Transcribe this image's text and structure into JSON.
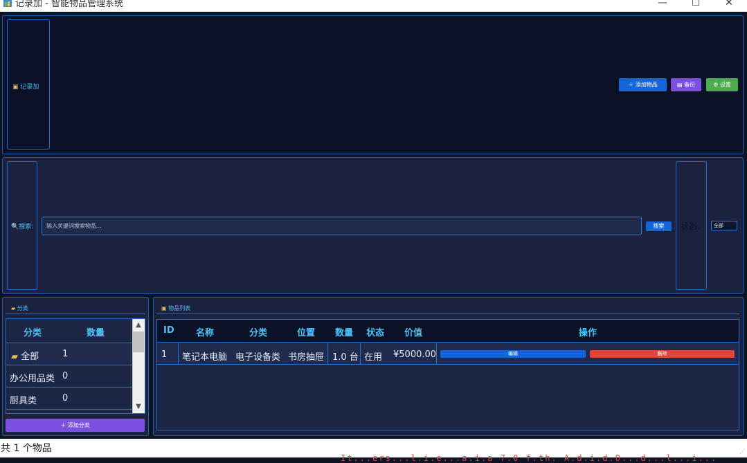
{
  "window": {
    "title": "记录加 - 智能物品管理系统",
    "controls": {
      "minimize": "—",
      "maximize": "☐",
      "close": "✕"
    }
  },
  "header": {
    "brand": "记录加",
    "buttons": {
      "add_item": "添加物品",
      "backup": "备份",
      "settings": "设置"
    }
  },
  "search": {
    "label": "搜索:",
    "placeholder": "输入关键词搜索物品...",
    "button": "搜索",
    "status_label": "状态:",
    "status_value": "全部"
  },
  "categories": {
    "title": "分类",
    "columns": [
      "分类",
      "数量"
    ],
    "rows": [
      {
        "name": "全部",
        "count": "1"
      },
      {
        "name": "办公用品类",
        "count": "0"
      },
      {
        "name": "厨具类",
        "count": "0"
      }
    ],
    "add_button": "添加分类"
  },
  "items": {
    "title": "物品列表",
    "columns": [
      "ID",
      "名称",
      "分类",
      "位置",
      "数量",
      "状态",
      "价值",
      "操作"
    ],
    "rows": [
      {
        "id": "1",
        "name": "笔记本电脑",
        "category": "电子设备类",
        "location": "书房抽屉",
        "quantity": "1.0 台",
        "status": "在用",
        "value": "¥5000.00",
        "edit": "编辑",
        "delete": "删除"
      }
    ]
  },
  "statusbar": {
    "count": "共 1 个物品",
    "console": "It...ers...l.i.e...a.i.a 7.0 f.th. A.d.i.d.O...d...l...i..."
  },
  "colors": {
    "background": "#0e1424",
    "panel": "#1a2240",
    "accent": "#4fc3f7",
    "border": "#1e6fd6",
    "primary": "#1565d8",
    "purple": "#7b4fe0",
    "green": "#4caa4f",
    "danger": "#e0443c"
  }
}
